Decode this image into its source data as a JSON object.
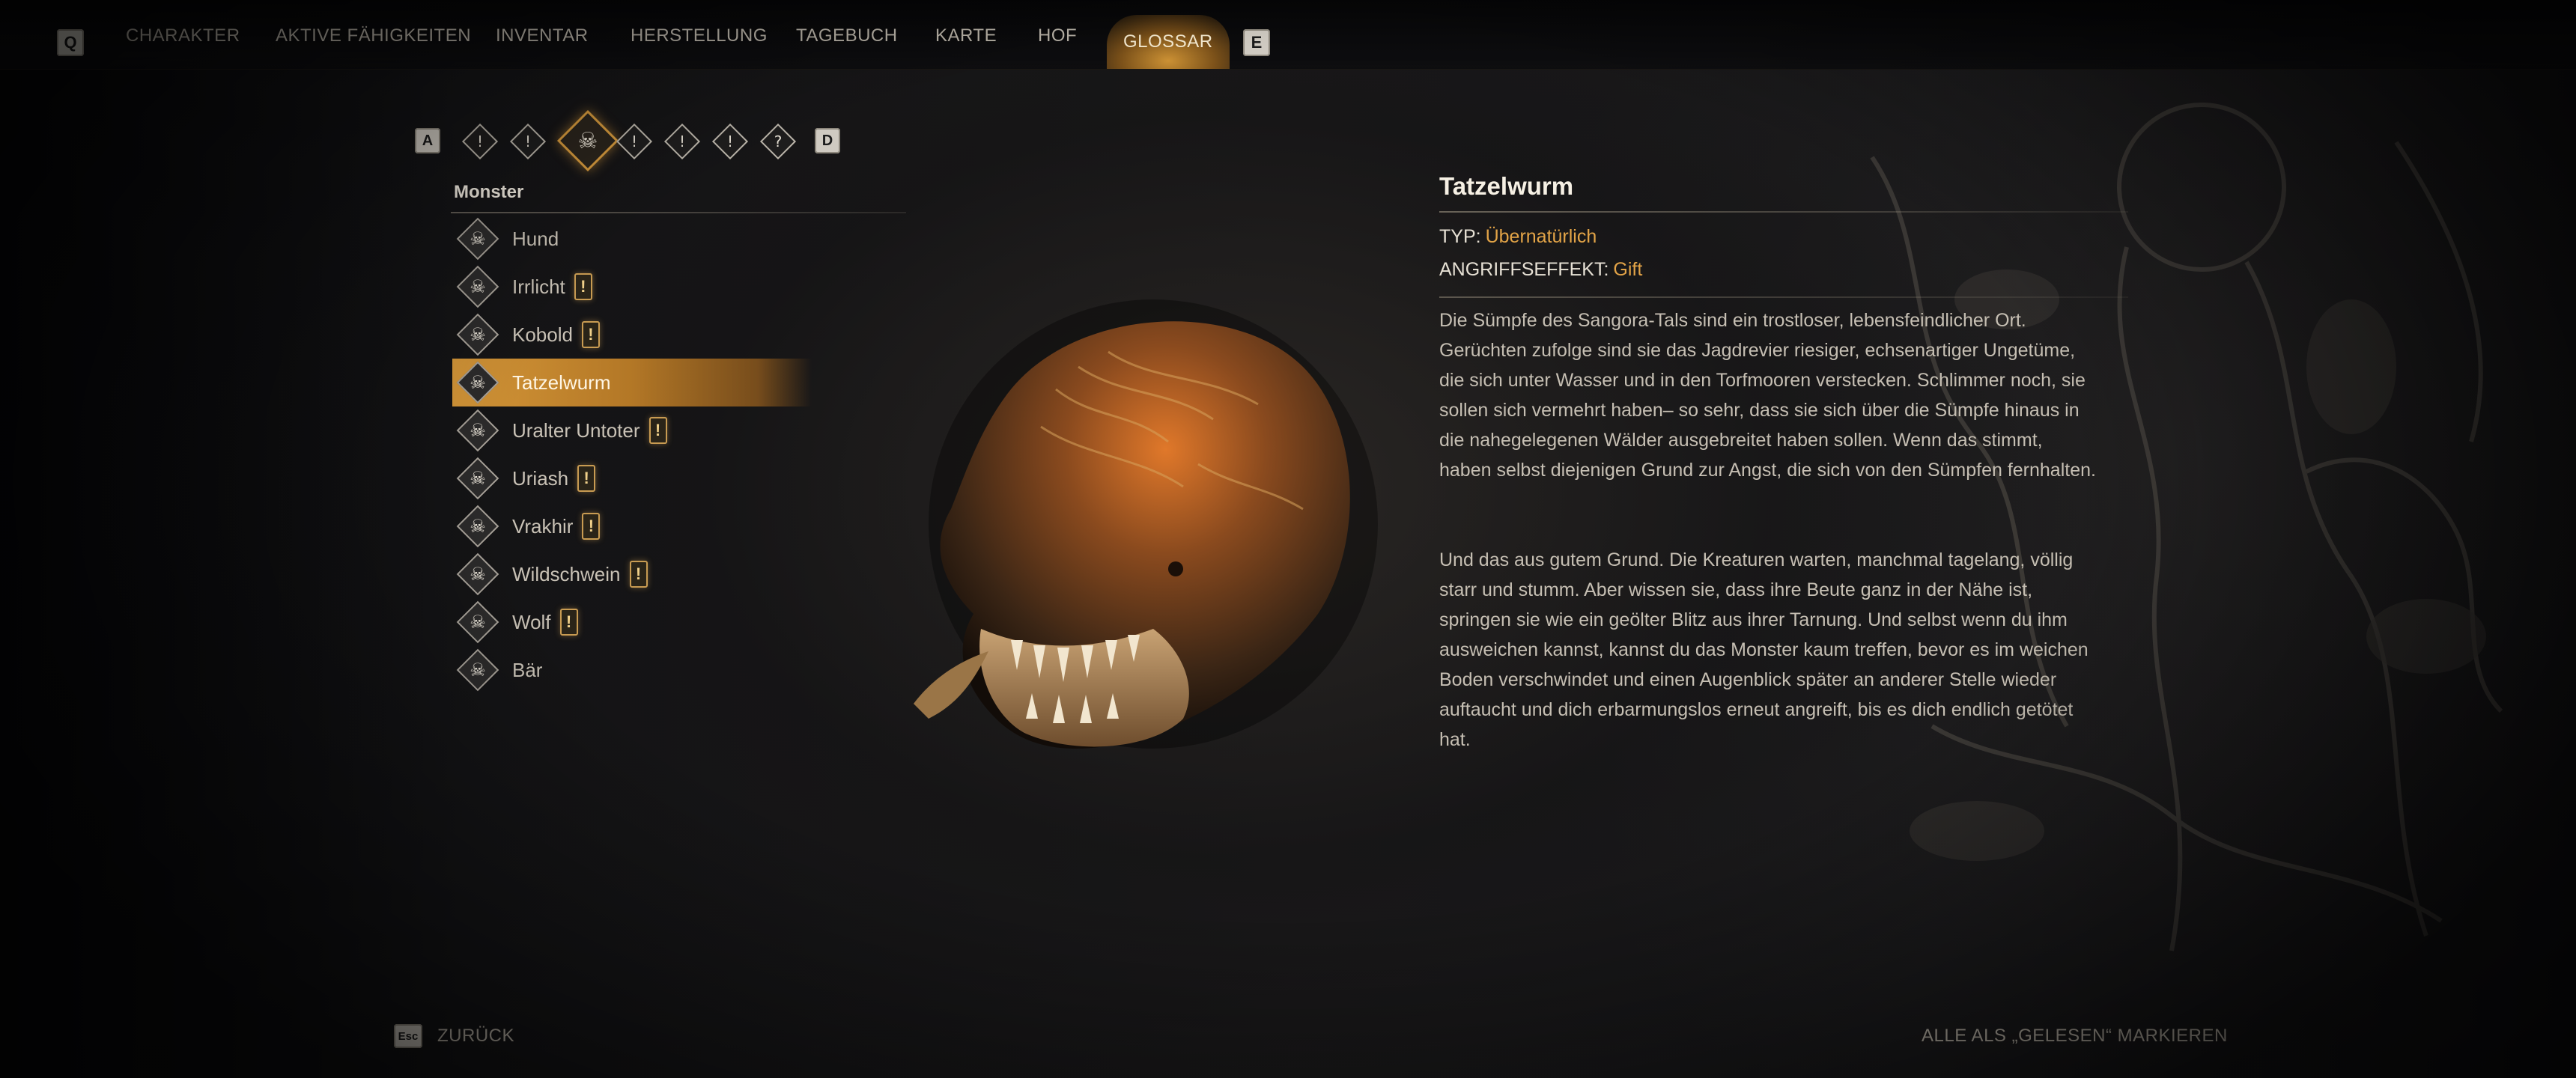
{
  "nav": {
    "left_key": "Q",
    "right_key": "E",
    "tabs": [
      {
        "label": "CHARAKTER"
      },
      {
        "label": "AKTIVE FÄHIGKEITEN"
      },
      {
        "label": "INVENTAR"
      },
      {
        "label": "HERSTELLUNG"
      },
      {
        "label": "TAGEBUCH"
      },
      {
        "label": "KARTE"
      },
      {
        "label": "HOF"
      },
      {
        "label": "GLOSSAR"
      }
    ],
    "active_tab": "GLOSSAR"
  },
  "categories": {
    "prev_key": "A",
    "next_key": "D",
    "icons": [
      {
        "icon": "book-icon",
        "glyph": "!"
      },
      {
        "icon": "scroll-icon",
        "glyph": "!"
      },
      {
        "icon": "monster-skull-icon",
        "glyph": "☠"
      },
      {
        "icon": "sword-icon",
        "glyph": "!"
      },
      {
        "icon": "tower-icon",
        "glyph": "!"
      },
      {
        "icon": "list-icon",
        "glyph": "!"
      },
      {
        "icon": "question-icon",
        "glyph": "?"
      }
    ],
    "active_index": 2
  },
  "list": {
    "header": "Monster",
    "items": [
      {
        "label": "Hund",
        "new": false
      },
      {
        "label": "Irrlicht",
        "new": true
      },
      {
        "label": "Kobold",
        "new": true
      },
      {
        "label": "Tatzelwurm",
        "new": false
      },
      {
        "label": "Uralter Untoter",
        "new": true
      },
      {
        "label": "Uriash",
        "new": true
      },
      {
        "label": "Vrakhir",
        "new": true
      },
      {
        "label": "Wildschwein",
        "new": true
      },
      {
        "label": "Wolf",
        "new": true
      },
      {
        "label": "Bär",
        "new": false
      }
    ],
    "selected_index": 3,
    "new_marker": "!"
  },
  "detail": {
    "title": "Tatzelwurm",
    "type_label": "TYP:",
    "type_value": "Übernatürlich",
    "attack_label": "ANGRIFFSEFFEKT:",
    "attack_value": "Gift",
    "paragraph1": "Die Sümpfe des Sangora-Tals sind ein trostloser, lebensfeindlicher Ort. Gerüchten zufolge sind sie das Jagdrevier riesiger, echsenartiger Ungetüme, die sich unter Wasser und in den Torfmooren verstecken. Schlimmer noch, sie sollen sich vermehrt haben– so sehr, dass sie sich über die Sümpfe hinaus in die nahegelegenen Wälder ausgebreitet haben sollen. Wenn das stimmt, haben selbst diejenigen Grund zur Angst, die sich von den Sümpfen fernhalten.",
    "paragraph2": "Und das aus gutem Grund. Die Kreaturen warten, manchmal tagelang, völlig starr und stumm. Aber wissen sie, dass ihre Beute ganz in der Nähe ist, springen sie wie ein geölter Blitz aus ihrer Tarnung. Und selbst wenn du ihm ausweichen kannst, kannst du das Monster kaum treffen, bevor es im weichen Boden verschwindet und einen Augenblick später an anderer Stelle wieder auftaucht und dich erbarmungslos erneut angreift, bis es dich endlich getötet hat."
  },
  "footer": {
    "back_key": "Esc",
    "back_label": "ZURÜCK",
    "mark_all_read": "ALLE ALS „GELESEN“ MARKIEREN"
  },
  "colors": {
    "accent": "#e3a447",
    "highlight": "#d69a3d"
  }
}
